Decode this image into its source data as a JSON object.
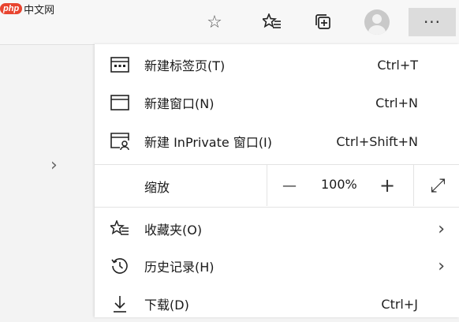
{
  "logo": {
    "badge": "php",
    "text": "中文网"
  },
  "toolbar": {
    "favorite_star_icon": "☆",
    "more_label": "···"
  },
  "menu": {
    "items": [
      {
        "label": "新建标签页(T)",
        "shortcut": "Ctrl+T",
        "icon": "new-tab-icon"
      },
      {
        "label": "新建窗口(N)",
        "shortcut": "Ctrl+N",
        "icon": "new-window-icon"
      },
      {
        "label": "新建 InPrivate 窗口(I)",
        "shortcut": "Ctrl+Shift+N",
        "icon": "inprivate-window-icon"
      }
    ],
    "zoom": {
      "label": "缩放",
      "minus": "—",
      "value": "100%",
      "plus": "+",
      "fullscreen": "⤢"
    },
    "lower_items": [
      {
        "label": "收藏夹(O)",
        "icon": "favorites-icon",
        "has_submenu": true
      },
      {
        "label": "历史记录(H)",
        "icon": "history-icon",
        "has_submenu": true
      },
      {
        "label": "下载(D)",
        "shortcut": "Ctrl+J",
        "icon": "download-icon"
      }
    ]
  },
  "left_pane": {
    "chevron": "›"
  },
  "submenu_arrow": "›"
}
